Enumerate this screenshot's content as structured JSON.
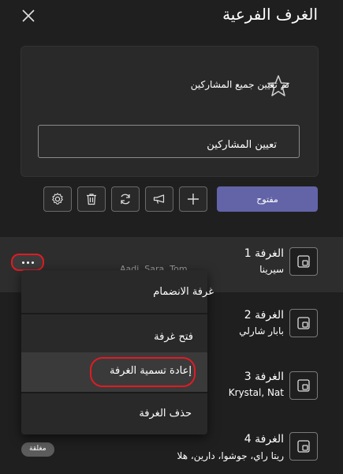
{
  "header": {
    "title": "الغرف الفرعية"
  },
  "assignment": {
    "status_text": "تم تعيين جميع المشاركين",
    "assign_button_label": "تعيين المشاركين"
  },
  "toolbar": {
    "open_label": "مفتوح"
  },
  "rooms": [
    {
      "name": "الغرفة 1",
      "members": "سيرينا",
      "members_faded": "Aadi, Sara, Tom"
    },
    {
      "name": "الغرفة 2",
      "members": "بابار شارلي"
    },
    {
      "name": "الغرفة 3",
      "members": "Krystal, Nat"
    },
    {
      "name": "الغرفة 4",
      "members": "ريتا راي، جوشوا، دارين، هلا",
      "status": "مغلقة"
    }
  ],
  "context_menu": {
    "items": [
      {
        "label": "غرفة الانضمام"
      },
      {
        "label": "فتح غرفة"
      },
      {
        "label": "إعادة تسمية الغرفة"
      },
      {
        "label": "حذف الغرفة"
      }
    ]
  },
  "colors": {
    "accent": "#6264a7",
    "highlight_ring": "#e01b24",
    "background": "#1f1f1f"
  }
}
